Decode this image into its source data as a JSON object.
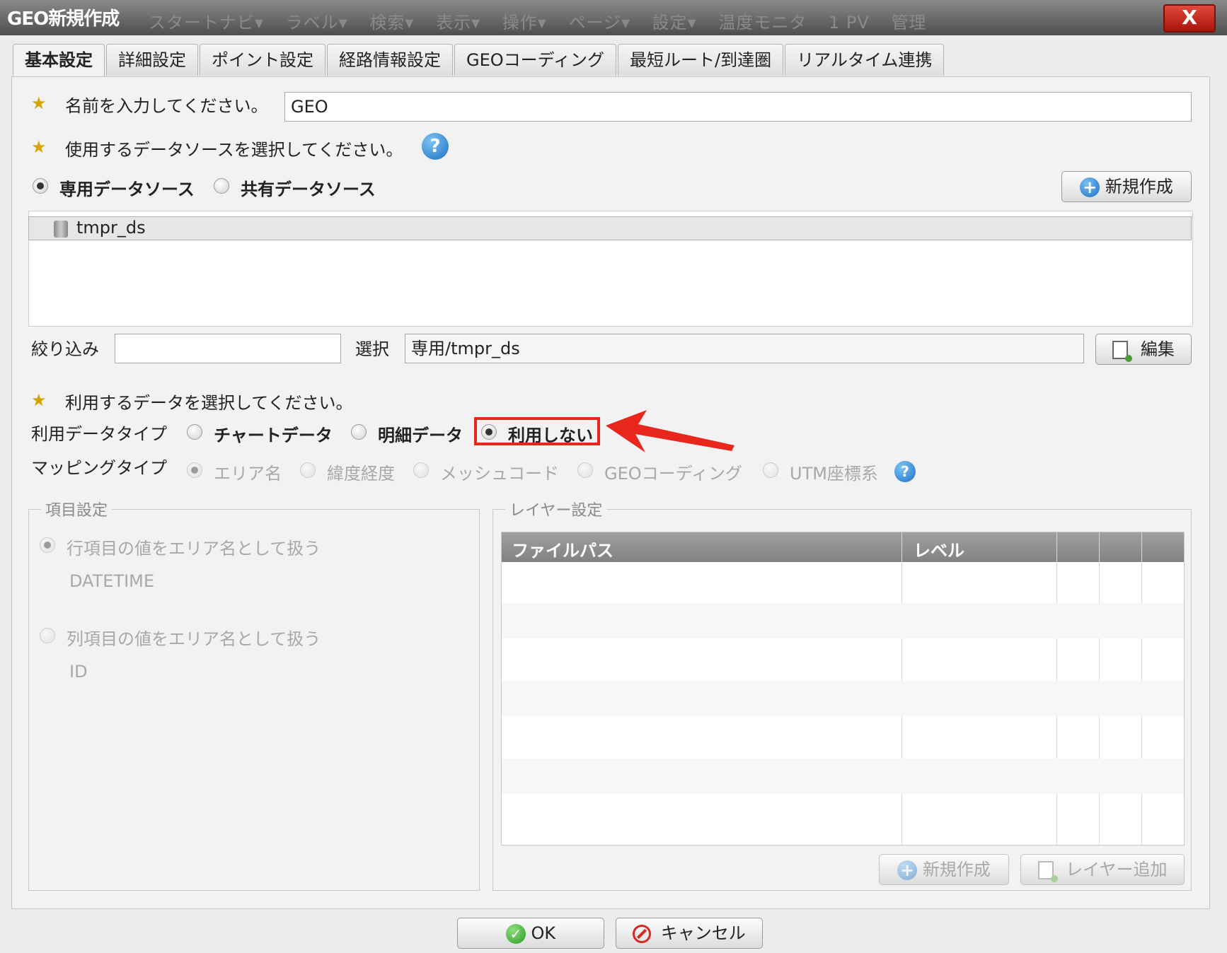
{
  "window": {
    "title": "GEO新規作成",
    "background_menu": [
      "スタートナビ▾",
      "ラベル▾",
      "検索▾",
      "表示▾",
      "操作▾",
      "ページ▾",
      "設定▾",
      "温度モニタ",
      "1 PV",
      "管理"
    ],
    "close_label": "X"
  },
  "tabs": [
    {
      "label": "基本設定",
      "active": true
    },
    {
      "label": "詳細設定"
    },
    {
      "label": "ポイント設定"
    },
    {
      "label": "経路情報設定"
    },
    {
      "label": "GEOコーディング"
    },
    {
      "label": "最短ルート/到達圏"
    },
    {
      "label": "リアルタイム連携"
    }
  ],
  "name_section": {
    "label": "名前を入力してください。",
    "value": "GEO"
  },
  "datasource_section": {
    "label": "使用するデータソースを選択してください。",
    "help": "?",
    "options": [
      "専用データソース",
      "共有データソース"
    ],
    "selected": "専用データソース",
    "new_button": "新規作成",
    "list": [
      "tmpr_ds"
    ],
    "filter_label": "絞り込み",
    "filter_value": "",
    "select_label": "選択",
    "select_value": "専用/tmpr_ds",
    "edit_button": "編集"
  },
  "data_section": {
    "label": "利用するデータを選択してください。",
    "datatype_label": "利用データタイプ",
    "datatype_options": [
      "チャートデータ",
      "明細データ",
      "利用しない"
    ],
    "datatype_selected": "利用しない",
    "mapping_label": "マッピングタイプ",
    "mapping_options": [
      "エリア名",
      "緯度経度",
      "メッシュコード",
      "GEOコーディング",
      "UTM座標系"
    ],
    "mapping_selected": "エリア名",
    "help": "?"
  },
  "item_settings": {
    "legend": "項目設定",
    "row_option": "行項目の値をエリア名として扱う",
    "row_value": "DATETIME",
    "col_option": "列項目の値をエリア名として扱う",
    "col_value": "ID"
  },
  "layer_settings": {
    "legend": "レイヤー設定",
    "columns": [
      "ファイルパス",
      "レベル",
      "",
      "",
      ""
    ],
    "new_button": "新規作成",
    "add_button": "レイヤー追加"
  },
  "footer": {
    "ok": "OK",
    "cancel": "キャンセル"
  },
  "colors": {
    "highlight": "#e8261c",
    "grid_header": "#8a8a8a"
  }
}
